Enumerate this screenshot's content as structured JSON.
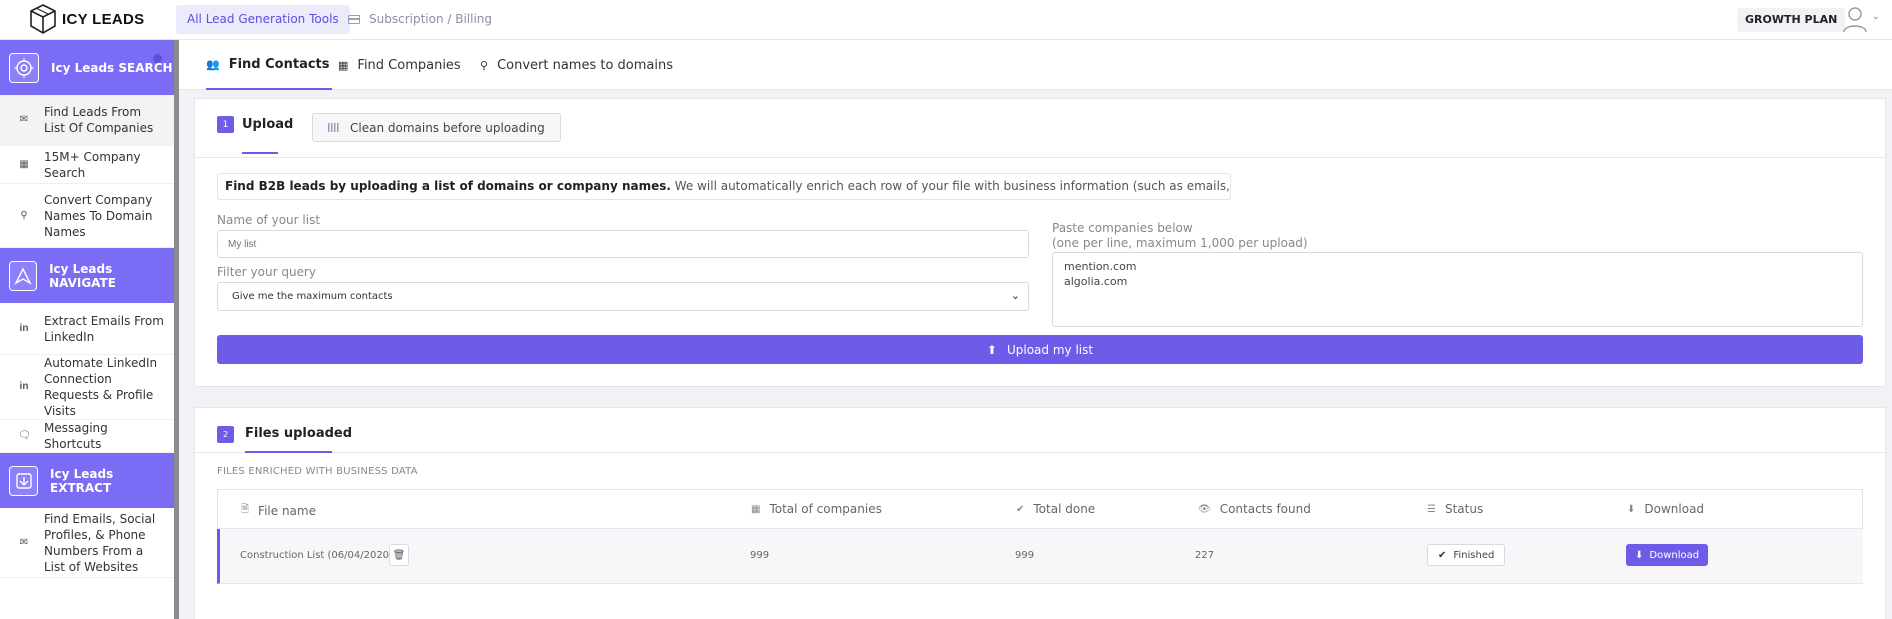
{
  "app": {
    "logo_text": "ICY LEADS",
    "top_tabs": [
      {
        "label": "All Lead Generation Tools"
      },
      {
        "label": "Subscription / Billing"
      }
    ],
    "plan_badge": "GROWTH PLAN"
  },
  "sidebar": {
    "sections": [
      {
        "title": "Icy Leads SEARCH",
        "icon": "search-target-icon"
      },
      {
        "title": "Icy Leads NAVIGATE",
        "icon": "navigate-icon"
      },
      {
        "title": "Icy Leads EXTRACT",
        "icon": "extract-icon"
      }
    ],
    "items": [
      {
        "label": "Find Leads From List Of Companies",
        "icon": "mail-icon"
      },
      {
        "label": "15M+ Company Search",
        "icon": "building-icon"
      },
      {
        "label": "Convert Company Names To Domain Names",
        "icon": "search-icon"
      },
      {
        "label": "Extract Emails From LinkedIn",
        "icon": "linkedin-icon"
      },
      {
        "label": "Automate LinkedIn Connection Requests & Profile Visits",
        "icon": "linkedin-icon"
      },
      {
        "label": "Messaging Shortcuts",
        "icon": "chat-icon"
      },
      {
        "label": "Find Emails, Social Profiles, & Phone Numbers From a List of Websites",
        "icon": "mail-icon"
      }
    ],
    "linkedin_glyph": "in"
  },
  "subtabs": [
    {
      "label": "Find Contacts",
      "icon": "users-icon"
    },
    {
      "label": "Find Companies",
      "icon": "building-icon"
    },
    {
      "label": "Convert names to domains",
      "icon": "search-icon"
    }
  ],
  "upload_card": {
    "step": "1",
    "title": "Upload",
    "clean_button": "Clean domains before uploading",
    "info_bold": "Find B2B leads by uploading a list of domains or company names.",
    "info_rest": " We will automatically enrich each row of your file with business information (such as emails, company data and employees).",
    "list_name_label": "Name of your list",
    "list_name_placeholder": "My list",
    "filter_label": "Filter your query",
    "filter_value": "Give me the maximum contacts",
    "paste_label_1": "Paste companies below",
    "paste_label_2": "(one per line, maximum 1,000 per upload)",
    "paste_lines": [
      "mention.com",
      "algolia.com"
    ],
    "upload_button": "Upload my list"
  },
  "files_card": {
    "step": "2",
    "title": "Files uploaded",
    "section_label": "FILES ENRICHED WITH BUSINESS DATA",
    "columns": [
      "File name",
      "Total of companies",
      "Total done",
      "Contacts found",
      "Status",
      "Download"
    ],
    "rows": [
      {
        "file_name": "Construction List (06/04/2020)",
        "total_companies": "999",
        "total_done": "999",
        "contacts_found": "227",
        "status": "Finished",
        "download": "Download"
      }
    ]
  },
  "colors": {
    "accent": "#6c5ce7",
    "sidebar_header": "#7b6cf6"
  }
}
